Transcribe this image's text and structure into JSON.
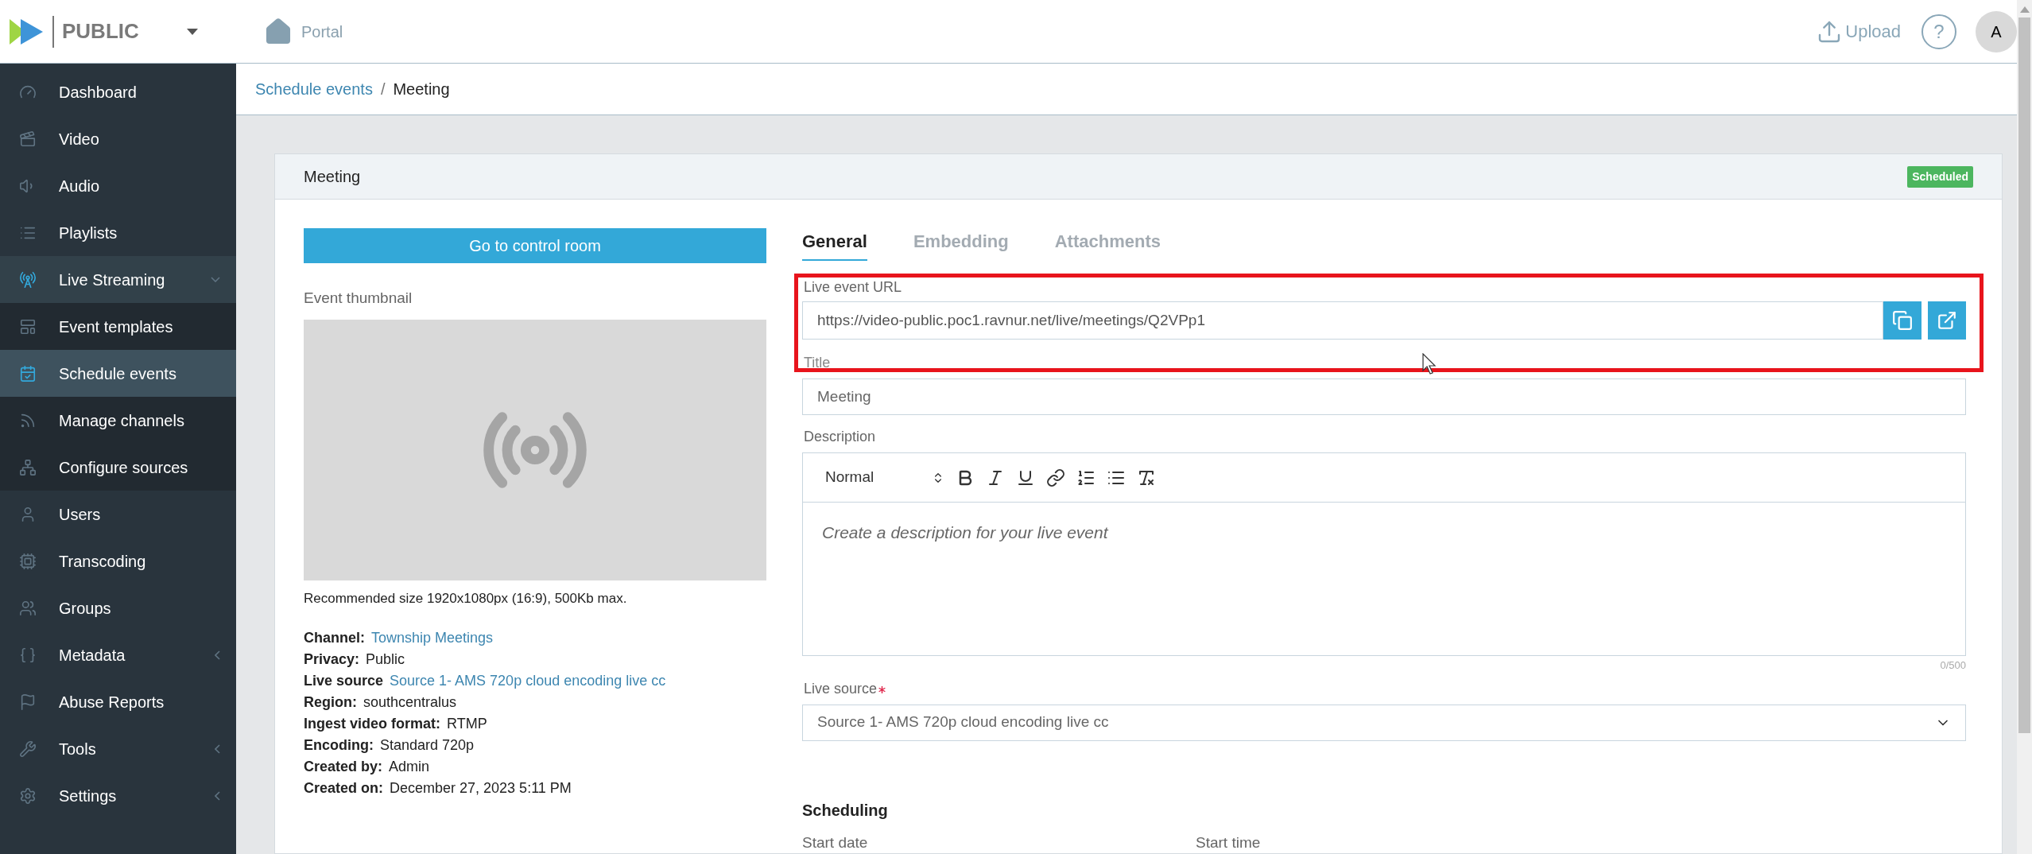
{
  "brand": {
    "name": "PUBLIC"
  },
  "topbar": {
    "portal": "Portal",
    "upload": "Upload",
    "help": "?",
    "avatar": "A"
  },
  "sidebar": {
    "items": [
      {
        "label": "Dashboard",
        "selected": false
      },
      {
        "label": "Video",
        "selected": false
      },
      {
        "label": "Audio",
        "selected": false
      },
      {
        "label": "Playlists",
        "selected": false
      },
      {
        "label": "Live Streaming",
        "selected": false,
        "expanded": true,
        "children": [
          {
            "label": "Event templates",
            "selected": false
          },
          {
            "label": "Schedule events",
            "selected": true
          },
          {
            "label": "Manage channels",
            "selected": false
          },
          {
            "label": "Configure sources",
            "selected": false
          }
        ]
      },
      {
        "label": "Users",
        "selected": false
      },
      {
        "label": "Transcoding",
        "selected": false
      },
      {
        "label": "Groups",
        "selected": false
      },
      {
        "label": "Metadata",
        "selected": false,
        "expanded": false
      },
      {
        "label": "Abuse Reports",
        "selected": false
      },
      {
        "label": "Tools",
        "selected": false,
        "expanded": false
      },
      {
        "label": "Settings",
        "selected": false,
        "expanded": false
      }
    ]
  },
  "breadcrumb": [
    {
      "label": "Schedule events",
      "kind": "link"
    },
    {
      "label": "/",
      "kind": "separator"
    },
    {
      "label": "Meeting",
      "kind": "current"
    }
  ],
  "card": {
    "title": "Meeting",
    "status": "Scheduled"
  },
  "left": {
    "control_room_button": "Go to control room",
    "thumbnail_label": "Event thumbnail",
    "thumbnail_hint": "Recommended size 1920x1080px (16:9), 500Kb max.",
    "details": [
      {
        "label": "Channel:",
        "value": "Township Meetings",
        "kind": "link"
      },
      {
        "label": "Privacy:",
        "value": "Public",
        "kind": "text"
      },
      {
        "label": "Live source",
        "value": "Source 1- AMS 720p cloud encoding live cc",
        "kind": "link"
      },
      {
        "label": "Region:",
        "value": "southcentralus",
        "kind": "text"
      },
      {
        "label": "Ingest video format:",
        "value": "RTMP",
        "kind": "text"
      },
      {
        "label": "Encoding:",
        "value": "Standard 720p",
        "kind": "text"
      },
      {
        "label": "Created by:",
        "value": "Admin",
        "kind": "text"
      },
      {
        "label": "Created on:",
        "value": "December 27, 2023 5:11 PM",
        "kind": "text"
      }
    ]
  },
  "tabs": [
    {
      "label": "General",
      "selected": true
    },
    {
      "label": "Embedding",
      "selected": false
    },
    {
      "label": "Attachments",
      "selected": false
    }
  ],
  "form": {
    "url": {
      "label": "Live event URL",
      "value": "https://video-public.poc1.ravnur.net/live/meetings/Q2VPp1"
    },
    "title": {
      "label": "Title",
      "value": "Meeting"
    },
    "description": {
      "label": "Description",
      "format": "Normal",
      "placeholder": "Create a description for your live event",
      "counter": "0/500"
    },
    "live_source": {
      "label": "Live source",
      "required": true,
      "value": "Source 1- AMS 720p cloud encoding live cc"
    },
    "scheduling": {
      "heading": "Scheduling",
      "start_date": "Start date",
      "start_time": "Start time"
    }
  }
}
